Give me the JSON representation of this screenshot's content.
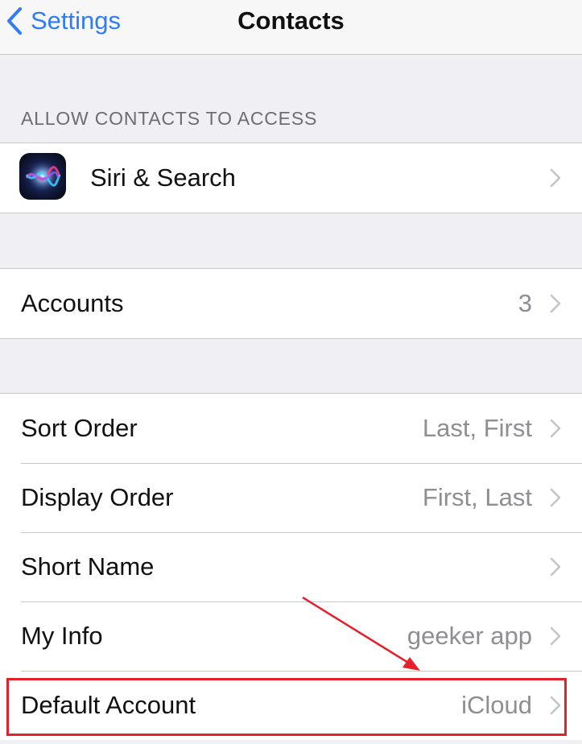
{
  "navbar": {
    "back_label": "Settings",
    "title": "Contacts"
  },
  "section_header": "ALLOW CONTACTS TO ACCESS",
  "siri_row": {
    "label": "Siri & Search",
    "icon": "siri-icon"
  },
  "accounts_row": {
    "label": "Accounts",
    "value": "3"
  },
  "settings_rows": [
    {
      "label": "Sort Order",
      "value": "Last, First"
    },
    {
      "label": "Display Order",
      "value": "First, Last"
    },
    {
      "label": "Short Name",
      "value": ""
    },
    {
      "label": "My Info",
      "value": "geeker app"
    },
    {
      "label": "Default Account",
      "value": "iCloud"
    }
  ],
  "colors": {
    "accent": "#2f7cf6",
    "annotation": "#e5202a",
    "background": "#efeff4",
    "secondary_text": "#8e8e93"
  }
}
